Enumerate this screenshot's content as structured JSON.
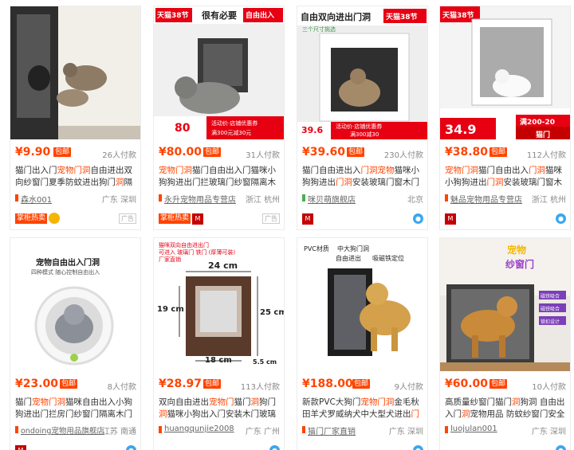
{
  "products": [
    {
      "img_text": [],
      "price": "¥9.90",
      "badge": "包邮",
      "sold": "26人付款",
      "title_parts": [
        "猫门出入门",
        "宠物门洞",
        "自由进出双向纱窗门夏季防蚊进出狗门",
        "洞",
        "隔墙门洞"
      ],
      "shop": "森水001",
      "location": "广东 深圳",
      "tag": "掌柜热卖",
      "icons": [
        "gold-medal-icon",
        "ad-icon"
      ],
      "ad_label": "广告"
    },
    {
      "img_text": [
        "天猫38节",
        "很有必要",
        "自由出入",
        "80",
        "活动价·店铺优惠券",
        "满300元减30元"
      ],
      "price": "¥80.00",
      "badge": "包邮",
      "sold": "31人付款",
      "title_parts": [
        "宠物门洞",
        "猫门自由出入门猫咪小狗狗进出门拦玻璃门纱窗隔离木门铁门"
      ],
      "shop": "永升宠物用品专营店",
      "location": "浙江 杭州",
      "tag": "掌柜热卖",
      "icons": [
        "tmall-icon",
        "ad-icon"
      ],
      "ad_label": "广告"
    },
    {
      "img_text": [
        "自由双向进出门洞",
        "天猫38节",
        "三个尺寸挑选",
        "39.6",
        "活动价·店铺优惠券",
        "满300减30"
      ],
      "price": "¥39.60",
      "badge": "包邮",
      "sold": "230人付款",
      "title_parts": [
        "猫门自由进出入",
        "门洞宠物",
        "猫咪小狗狗进出",
        "门洞",
        "安装玻璃门窗木门铁门"
      ],
      "shop": "咪贝萌旗舰店",
      "location": "北京",
      "tag": "",
      "icons": [
        "tmall-icon",
        "wangwang-icon"
      ],
      "ad_label": ""
    },
    {
      "img_text": [
        "天猫38节",
        "34.9",
        "满200-20",
        "猫门"
      ],
      "price": "¥38.80",
      "badge": "包邮",
      "sold": "112人付款",
      "title_parts": [
        "宠物门洞",
        "猫门自由出入",
        "门洞",
        "猫咪小狗狗进出",
        "门洞",
        "安装玻璃门窗木门铁门"
      ],
      "shop": "魅品宠物用品专营店",
      "location": "浙江 杭州",
      "tag": "",
      "icons": [
        "tmall-icon",
        "wangwang-icon"
      ],
      "ad_label": ""
    },
    {
      "img_text": [
        "宠物自由出入门洞",
        "四种模式 随心控制自由出入"
      ],
      "price": "¥23.00",
      "badge": "包邮",
      "sold": "8人付款",
      "title_parts": [
        "猫门",
        "宠物门洞",
        "猫咪自由出入小狗狗进出门拦房门纱窗门隔离木门铁门"
      ],
      "shop": "ondoing宠物用品旗舰店",
      "location": "江苏 南通",
      "tag": "",
      "icons": [
        "tmall-icon",
        "wangwang-icon"
      ],
      "ad_label": ""
    },
    {
      "img_text": [
        "猫咪双向自由进出门",
        "可进入 玻璃门 铁门 (厚薄可装)",
        "厂家直销",
        "24 cm",
        "19 cm",
        "25 cm",
        "18 cm",
        "5.5 cm"
      ],
      "price": "¥28.97",
      "badge": "包邮",
      "sold": "113人付款",
      "title_parts": [
        "双向自由进出",
        "宠物门",
        "猫门",
        "洞",
        "狗门",
        "洞",
        "猫咪小狗出入门安装木门玻璃门",
        "门洞"
      ],
      "shop": "huangqunjie2008",
      "location": "广东 广州",
      "tag": "",
      "icons": [
        "wangwang-icon"
      ],
      "ad_label": ""
    },
    {
      "img_text": [
        "PVC材质",
        "中大狗门洞",
        "自由进出",
        "吸磁铁定位"
      ],
      "price": "¥188.00",
      "badge": "包邮",
      "sold": "9人付款",
      "title_parts": [
        "新款PVC大狗门",
        "宠物门洞",
        "金毛秋田羊犬罗威纳犬中大型犬进出",
        "门洞"
      ],
      "shop": "猫门厂家直销",
      "location": "广东 深圳",
      "tag": "",
      "icons": [
        "wangwang-icon"
      ],
      "ad_label": ""
    },
    {
      "img_text": [
        "宠物",
        "纱窗门",
        "磁铁吸合",
        "磁铁吸合",
        "锁扣设计"
      ],
      "price": "¥60.00",
      "badge": "包邮",
      "sold": "10人付款",
      "title_parts": [
        "高质量纱窗门猫门",
        "洞",
        "狗洞 自由出入门",
        "洞",
        "宠物用品 防蚊纱窗门安全门"
      ],
      "shop": "luojulan001",
      "location": "广东 深圳",
      "tag": "",
      "icons": [
        "wangwang-icon"
      ],
      "ad_label": ""
    }
  ],
  "colors": {
    "accent": "#ff4400",
    "tmall_red": "#c40000",
    "price": "#ff4400"
  }
}
